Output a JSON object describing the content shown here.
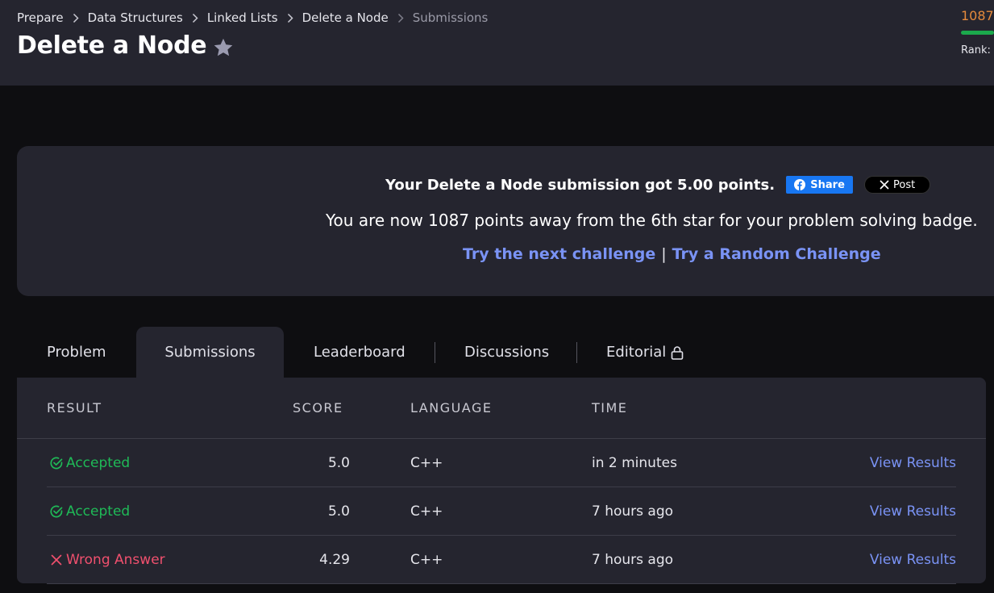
{
  "breadcrumb": [
    "Prepare",
    "Data Structures",
    "Linked Lists",
    "Delete a Node",
    "Submissions"
  ],
  "page_title": "Delete a Node",
  "user": {
    "points": "1087",
    "rank_label": "Rank:"
  },
  "banner": {
    "message": "Your Delete a Node submission got 5.00 points.",
    "share_label": "Share",
    "post_label": "Post",
    "progress_message": "You are now 1087 points away from the 6th star for your problem solving badge.",
    "next_challenge": "Try the next challenge",
    "separator": "|",
    "random_challenge": "Try a Random Challenge"
  },
  "tabs": [
    {
      "label": "Problem",
      "active": false
    },
    {
      "label": "Submissions",
      "active": true
    },
    {
      "label": "Leaderboard",
      "active": false
    },
    {
      "label": "Discussions",
      "active": false
    },
    {
      "label": "Editorial",
      "active": false,
      "locked": true
    }
  ],
  "table": {
    "headers": [
      "RESULT",
      "SCORE",
      "LANGUAGE",
      "TIME"
    ],
    "rows": [
      {
        "result": "Accepted",
        "status": "accepted",
        "score": "5.0",
        "language": "C++",
        "time": "in 2 minutes",
        "action": "View Results"
      },
      {
        "result": "Accepted",
        "status": "accepted",
        "score": "5.0",
        "language": "C++",
        "time": "7 hours ago",
        "action": "View Results"
      },
      {
        "result": "Wrong Answer",
        "status": "wrong",
        "score": "4.29",
        "language": "C++",
        "time": "7 hours ago",
        "action": "View Results"
      }
    ]
  },
  "colors": {
    "accent_link": "#7a93f5",
    "accepted": "#1fba57",
    "wrong": "#f0506e",
    "points": "#e58a3c",
    "panel": "#25252f",
    "background": "#0e0e11"
  },
  "icons": [
    "chevron-right-icon",
    "star-icon",
    "facebook-icon",
    "x-icon",
    "lock-icon",
    "check-circle-icon",
    "cross-icon"
  ]
}
